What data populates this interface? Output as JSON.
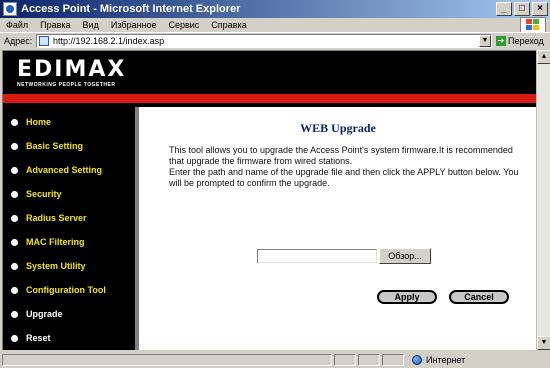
{
  "window": {
    "title": "Access Point - Microsoft Internet Explorer",
    "btn_min": "_",
    "btn_max": "□",
    "btn_close": "×"
  },
  "menu": {
    "items": [
      "Файл",
      "Правка",
      "Вид",
      "Избранное",
      "Сервис",
      "Справка"
    ]
  },
  "address": {
    "label": "Адрес:",
    "url": "http://192.168.2.1/index.asp",
    "go_label": "Переход"
  },
  "header": {
    "brand": "EDIMAX",
    "tagline": "NETWORKING PEOPLE TOGETHER"
  },
  "sidebar": {
    "items": [
      {
        "label": "Home"
      },
      {
        "label": "Basic Setting"
      },
      {
        "label": "Advanced Setting"
      },
      {
        "label": "Security"
      },
      {
        "label": "Radius Server"
      },
      {
        "label": "MAC Filtering"
      },
      {
        "label": "System Utility"
      },
      {
        "label": "Configuration Tool"
      },
      {
        "label": "Upgrade"
      },
      {
        "label": "Reset"
      }
    ]
  },
  "main": {
    "title": "WEB Upgrade",
    "desc_line1": "This tool allows you to upgrade the Access Point's system firmware.It is recommended that upgrade the firmware from wired stations.",
    "desc_line2": "Enter the path and name of the upgrade file and then click the APPLY button below. You will be prompted to confirm the upgrade.",
    "file_value": "",
    "browse_label": "Обзор...",
    "apply_label": "Apply",
    "cancel_label": "Cancel"
  },
  "status": {
    "zone": "Интернет"
  },
  "colors": {
    "sidebar_text": "#f2e600",
    "header_bg": "#000000",
    "red_bar": "#d81b10",
    "title_text": "#0a1f7a"
  }
}
